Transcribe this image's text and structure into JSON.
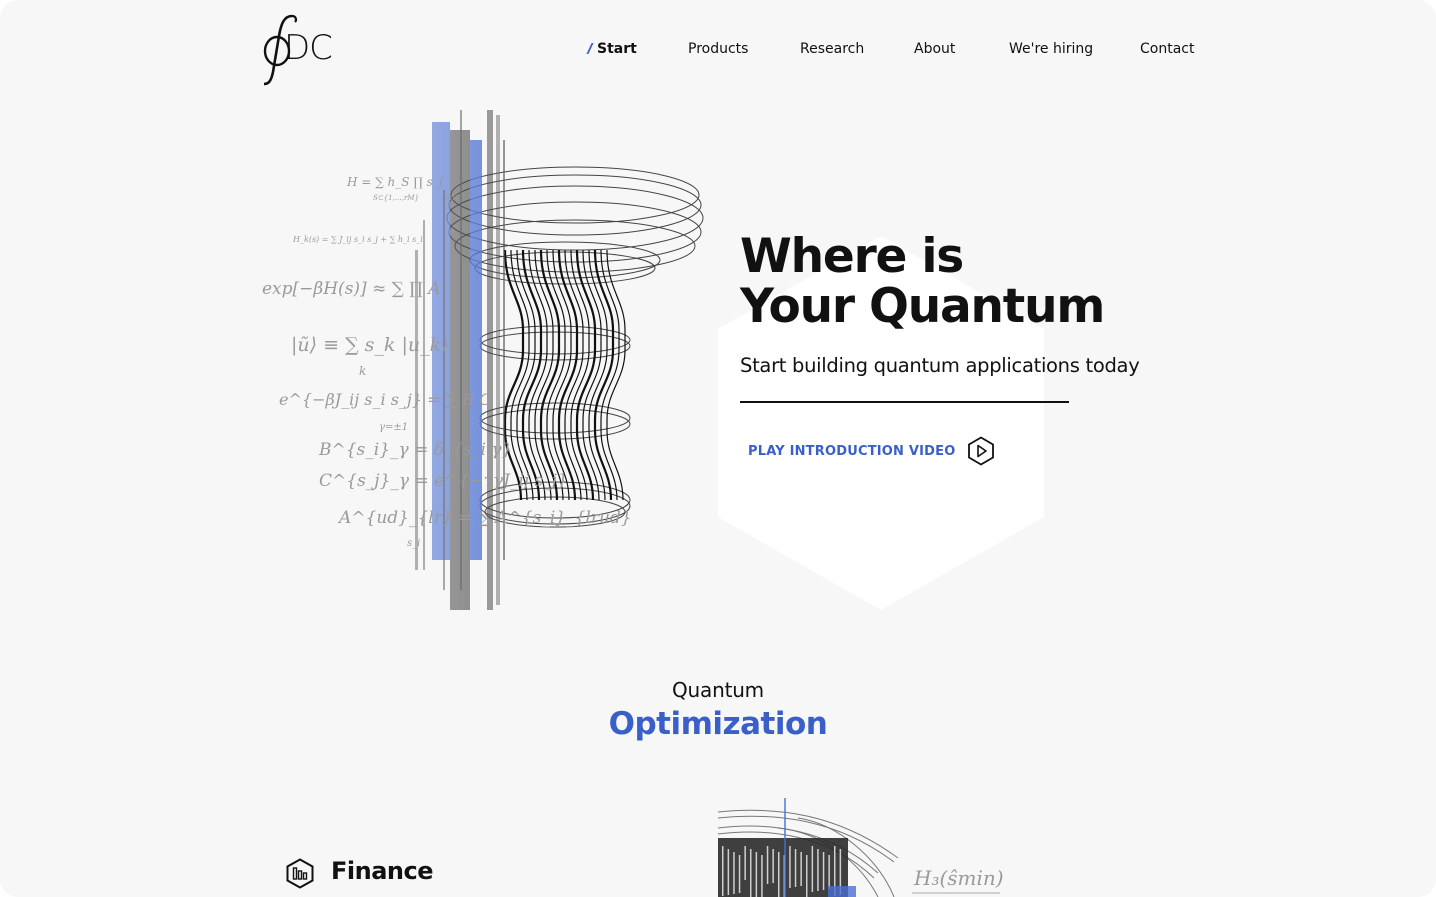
{
  "brand": {
    "logo_text": "DC",
    "logo_symbol": "integral-phi"
  },
  "nav": {
    "items": [
      {
        "label": "Start",
        "active": true
      },
      {
        "label": "Products",
        "active": false
      },
      {
        "label": "Research",
        "active": false
      },
      {
        "label": "About",
        "active": false
      },
      {
        "label": "We're hiring",
        "active": false
      },
      {
        "label": "Contact",
        "active": false
      }
    ]
  },
  "hero": {
    "title_line1": "Where is",
    "title_line2": "Your Quantum",
    "subtitle": "Start building quantum applications today",
    "cta_label": "PLAY INTRODUCTION VIDEO",
    "cta_icon": "play-icon",
    "illustration": {
      "equations": [
        "H = ∑ h_S ∏ s_i",
        "H_k(s) = ∑ J_ij s_i s_j + ∑ h_i s_i",
        "exp[−βH(s)] ≈ ∑ ∏ A",
        "|ũ⟩ ≡ ∑ s_k |u_k⟩",
        "e^{−βJ_ij s_i s_j} = ∑ B C",
        "B^{s_i}_γ = δ_{s_i γ}",
        "C^{s_j}_γ = e^{−τγJ_ij s_j}",
        "A^{ud}_{lr} = ∑ A^{s_i}_{lrud}"
      ],
      "labels": {
        "sum_sub": "S⊂{1,…,rM}",
        "sum_k": "k",
        "sum_gamma": "γ=±1",
        "sum_si": "s_i",
        "prod_i": "i∈S"
      }
    }
  },
  "section": {
    "kicker": "Quantum",
    "title": "Optimization",
    "finance_label": "Finance",
    "finance_icon": "bar-chart-hexagon-icon",
    "bottom_equation": "H₃(ŝmin)"
  },
  "colors": {
    "accent": "#3a5fc8",
    "text": "#111111",
    "background": "#f7f7f7",
    "hexagon": "#ffffff"
  }
}
